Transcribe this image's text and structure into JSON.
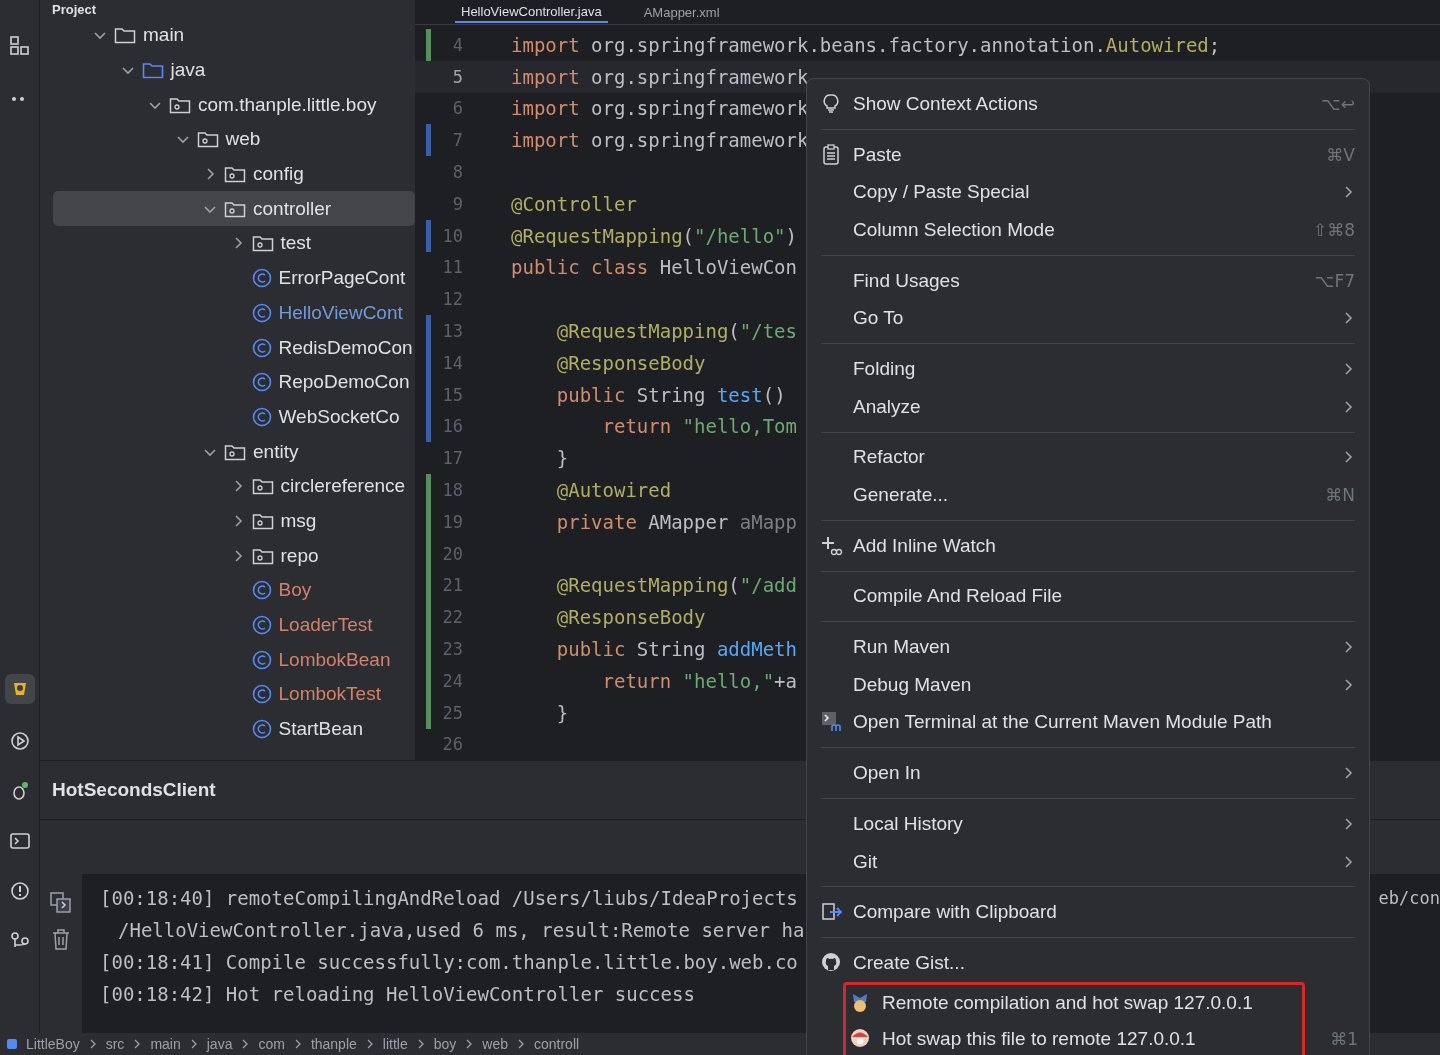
{
  "project_panel": {
    "title": "Project",
    "tree": [
      {
        "label": "main",
        "kind": "folder",
        "expanded": true,
        "selected": false,
        "color": "#dfe1e5",
        "children": [
          {
            "label": "java",
            "kind": "source",
            "expanded": true,
            "selected": false,
            "color": "#dfe1e5",
            "children": [
              {
                "label": "com.thanple.little.boy",
                "kind": "package",
                "expanded": true,
                "selected": false,
                "color": "#dfe1e5",
                "children": [
                  {
                    "label": "web",
                    "kind": "package",
                    "expanded": true,
                    "selected": false,
                    "color": "#dfe1e5",
                    "children": [
                      {
                        "label": "config",
                        "kind": "package",
                        "expanded": false,
                        "selected": false,
                        "color": "#dfe1e5"
                      },
                      {
                        "label": "controller",
                        "kind": "package",
                        "expanded": true,
                        "selected": true,
                        "color": "#dfe1e5",
                        "children": [
                          {
                            "label": "test",
                            "kind": "package",
                            "expanded": false,
                            "selected": false,
                            "color": "#dfe1e5"
                          },
                          {
                            "label": "ErrorPageCont",
                            "kind": "class",
                            "selected": false,
                            "color": "#dfe1e5"
                          },
                          {
                            "label": "HelloViewCont",
                            "kind": "class",
                            "selected": false,
                            "color": "#6f9bdc"
                          },
                          {
                            "label": "RedisDemoCon",
                            "kind": "class",
                            "selected": false,
                            "color": "#dfe1e5"
                          },
                          {
                            "label": "RepoDemoCon",
                            "kind": "class",
                            "selected": false,
                            "color": "#dfe1e5"
                          },
                          {
                            "label": "WebSocketCo",
                            "kind": "class",
                            "selected": false,
                            "color": "#dfe1e5"
                          }
                        ]
                      },
                      {
                        "label": "entity",
                        "kind": "package",
                        "expanded": true,
                        "selected": false,
                        "color": "#dfe1e5",
                        "children": [
                          {
                            "label": "circlereference",
                            "kind": "package",
                            "expanded": false,
                            "selected": false,
                            "color": "#dfe1e5"
                          },
                          {
                            "label": "msg",
                            "kind": "package",
                            "expanded": false,
                            "selected": false,
                            "color": "#dfe1e5"
                          },
                          {
                            "label": "repo",
                            "kind": "package",
                            "expanded": false,
                            "selected": false,
                            "color": "#dfe1e5"
                          },
                          {
                            "label": "Boy",
                            "kind": "class",
                            "selected": false,
                            "color": "#d5806a"
                          },
                          {
                            "label": "LoaderTest",
                            "kind": "class",
                            "selected": false,
                            "color": "#d5806a"
                          },
                          {
                            "label": "LombokBean",
                            "kind": "class",
                            "selected": false,
                            "color": "#d5806a"
                          },
                          {
                            "label": "LombokTest",
                            "kind": "class",
                            "selected": false,
                            "color": "#d5806a"
                          },
                          {
                            "label": "StartBean",
                            "kind": "class",
                            "selected": false,
                            "color": "#dfe1e5"
                          }
                        ]
                      }
                    ]
                  }
                ]
              }
            ]
          }
        ]
      }
    ]
  },
  "editor": {
    "tabs": [
      {
        "label": "HelloViewController.java",
        "selected": true
      },
      {
        "label": "AMapper.xml",
        "selected": false
      }
    ],
    "lines": [
      {
        "number": "4",
        "color": "#549159",
        "current": false,
        "tokens": [
          {
            "kind": "keyword",
            "text": "import "
          },
          {
            "kind": "plain",
            "text": "org.springframework.beans.factory.annotation."
          },
          {
            "kind": "annotation",
            "text": "Autowired"
          },
          {
            "kind": "plain",
            "text": ";"
          }
        ]
      },
      {
        "number": "5",
        "current": true,
        "tokens": [
          {
            "kind": "keyword",
            "text": "import "
          },
          {
            "kind": "plain",
            "text": "org.springframework"
          }
        ]
      },
      {
        "number": "6",
        "current": false,
        "tokens": [
          {
            "kind": "keyword",
            "text": "import "
          },
          {
            "kind": "plain",
            "text": "org.springframework"
          }
        ]
      },
      {
        "number": "7",
        "color": "#375fad",
        "current": false,
        "tokens": [
          {
            "kind": "keyword",
            "text": "import "
          },
          {
            "kind": "plain",
            "text": "org.springframework"
          }
        ]
      },
      {
        "number": "8",
        "current": false
      },
      {
        "number": "9",
        "current": false,
        "tokens": [
          {
            "kind": "annotation",
            "text": "@Controller"
          }
        ]
      },
      {
        "number": "10",
        "color": "#375fad",
        "current": false,
        "tokens": [
          {
            "kind": "annotation",
            "text": "@RequestMapping"
          },
          {
            "kind": "plain",
            "text": "("
          },
          {
            "kind": "string",
            "text": "\"/hello\""
          },
          {
            "kind": "plain",
            "text": ")"
          }
        ]
      },
      {
        "number": "11",
        "current": false,
        "tokens": [
          {
            "kind": "keyword",
            "text": "public class "
          },
          {
            "kind": "plain",
            "text": "HelloViewCon"
          }
        ]
      },
      {
        "number": "12",
        "current": false
      },
      {
        "number": "13",
        "color": "#375fad",
        "current": false,
        "tokens": [
          {
            "kind": "annotation",
            "text": "    @RequestMapping"
          },
          {
            "kind": "plain",
            "text": "("
          },
          {
            "kind": "string",
            "text": "\"/tes"
          }
        ]
      },
      {
        "number": "14",
        "color": "#375fad",
        "current": false,
        "tokens": [
          {
            "kind": "annotation",
            "text": "    @ResponseBody"
          }
        ]
      },
      {
        "number": "15",
        "color": "#375fad",
        "current": false,
        "tokens": [
          {
            "kind": "keyword",
            "text": "    public "
          },
          {
            "kind": "plain",
            "text": "String "
          },
          {
            "kind": "method",
            "text": "test"
          },
          {
            "kind": "plain",
            "text": "()"
          }
        ]
      },
      {
        "number": "16",
        "color": "#375fad",
        "current": false,
        "tokens": [
          {
            "kind": "keyword",
            "text": "        return "
          },
          {
            "kind": "string",
            "text": "\"hello,Tom"
          }
        ]
      },
      {
        "number": "17",
        "current": false,
        "tokens": [
          {
            "kind": "plain",
            "text": "    }"
          }
        ]
      },
      {
        "number": "18",
        "color": "#549159",
        "current": false,
        "tokens": [
          {
            "kind": "annotation",
            "text": "    @Autowired"
          }
        ]
      },
      {
        "number": "19",
        "color": "#549159",
        "current": false,
        "tokens": [
          {
            "kind": "keyword",
            "text": "    private "
          },
          {
            "kind": "plain",
            "text": "AMapper "
          },
          {
            "kind": "unused",
            "text": "aMapp"
          }
        ]
      },
      {
        "number": "20",
        "color": "#549159",
        "current": false
      },
      {
        "number": "21",
        "color": "#549159",
        "current": false,
        "tokens": [
          {
            "kind": "annotation",
            "text": "    @RequestMapping"
          },
          {
            "kind": "plain",
            "text": "("
          },
          {
            "kind": "string",
            "text": "\"/add"
          }
        ]
      },
      {
        "number": "22",
        "color": "#549159",
        "current": false,
        "tokens": [
          {
            "kind": "annotation",
            "text": "    @ResponseBody"
          }
        ]
      },
      {
        "number": "23",
        "color": "#549159",
        "current": false,
        "tokens": [
          {
            "kind": "keyword",
            "text": "    public "
          },
          {
            "kind": "plain",
            "text": "String "
          },
          {
            "kind": "method",
            "text": "addMeth"
          }
        ]
      },
      {
        "number": "24",
        "color": "#549159",
        "current": false,
        "tokens": [
          {
            "kind": "keyword",
            "text": "        return "
          },
          {
            "kind": "string",
            "text": "\"hello,\""
          },
          {
            "kind": "plain",
            "text": "+a"
          }
        ]
      },
      {
        "number": "25",
        "color": "#549159",
        "current": false,
        "tokens": [
          {
            "kind": "plain",
            "text": "    }"
          }
        ]
      },
      {
        "number": "26",
        "current": false
      }
    ]
  },
  "console": {
    "title": "HotSecondsClient",
    "lines": [
      {
        "text": "[00:18:40] remoteCompilingAndReload /Users/liubs/IdeaProjects",
        "continued": false
      },
      {
        "text": "/HelloViewController.java,used 6 ms, result:Remote server ha",
        "continued": true
      },
      {
        "text": "[00:18:41] Compile successfully:com.thanple.little.boy.web.co",
        "continued": false
      },
      {
        "text": "[00:18:42] Hot reloading HelloViewController success",
        "continued": false
      }
    ],
    "overflow_text": "eb/con"
  },
  "breadcrumb": [
    "LittleBoy",
    "src",
    "main",
    "java",
    "com",
    "thanple",
    "little",
    "boy",
    "web",
    "controll"
  ],
  "context_menu": [
    {
      "kind": "item",
      "label": "Show Context Actions",
      "shortcut": "⌥↩",
      "submenu": false,
      "outlined": false
    },
    {
      "kind": "separator"
    },
    {
      "kind": "item",
      "label": "Paste",
      "shortcut": "⌘V",
      "submenu": false,
      "outlined": false
    },
    {
      "kind": "item",
      "label": "Copy / Paste Special",
      "submenu": true,
      "outlined": false
    },
    {
      "kind": "item",
      "label": "Column Selection Mode",
      "shortcut": "⇧⌘8",
      "submenu": false,
      "outlined": false
    },
    {
      "kind": "separator"
    },
    {
      "kind": "item",
      "label": "Find Usages",
      "shortcut": "⌥F7",
      "submenu": false,
      "outlined": false
    },
    {
      "kind": "item",
      "label": "Go To",
      "submenu": true,
      "outlined": false
    },
    {
      "kind": "separator"
    },
    {
      "kind": "item",
      "label": "Folding",
      "submenu": true,
      "outlined": false
    },
    {
      "kind": "item",
      "label": "Analyze",
      "submenu": true,
      "outlined": false
    },
    {
      "kind": "separator"
    },
    {
      "kind": "item",
      "label": "Refactor",
      "submenu": true,
      "outlined": false
    },
    {
      "kind": "item",
      "label": "Generate...",
      "shortcut": "⌘N",
      "submenu": false,
      "outlined": false
    },
    {
      "kind": "separator"
    },
    {
      "kind": "item",
      "label": "Add Inline Watch",
      "submenu": false,
      "outlined": false
    },
    {
      "kind": "separator"
    },
    {
      "kind": "item",
      "label": "Compile And Reload File",
      "submenu": false,
      "outlined": false
    },
    {
      "kind": "separator"
    },
    {
      "kind": "item",
      "label": "Run Maven",
      "submenu": true,
      "outlined": false
    },
    {
      "kind": "item",
      "label": "Debug Maven",
      "submenu": true,
      "outlined": false
    },
    {
      "kind": "item",
      "label": "Open Terminal at the Current Maven Module Path",
      "submenu": false,
      "outlined": false
    },
    {
      "kind": "separator"
    },
    {
      "kind": "item",
      "label": "Open In",
      "submenu": true,
      "outlined": false
    },
    {
      "kind": "separator"
    },
    {
      "kind": "item",
      "label": "Local History",
      "submenu": true,
      "outlined": false
    },
    {
      "kind": "item",
      "label": "Git",
      "submenu": true,
      "outlined": false
    },
    {
      "kind": "separator"
    },
    {
      "kind": "item",
      "label": "Compare with Clipboard",
      "submenu": false,
      "outlined": false
    },
    {
      "kind": "separator"
    },
    {
      "kind": "item",
      "label": "Create Gist...",
      "submenu": false,
      "outlined": false
    },
    {
      "kind": "item",
      "label": "Remote compilation and hot swap 127.0.0.1",
      "submenu": false,
      "outlined": true
    },
    {
      "kind": "item",
      "label": "Hot swap this file to remote 127.0.0.1",
      "shortcut": "⌘1",
      "submenu": false,
      "outlined": true
    }
  ]
}
